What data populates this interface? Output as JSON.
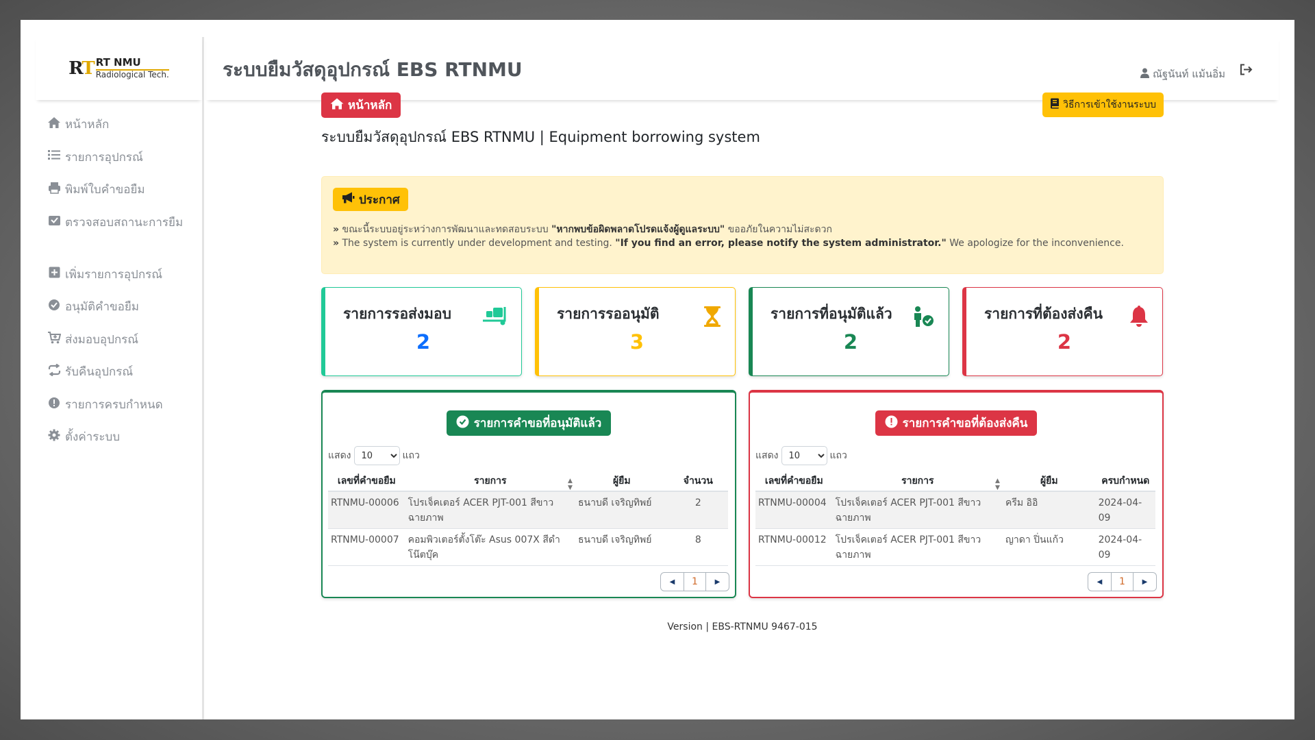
{
  "brand": {
    "mark": "RT",
    "line1": "RT NMU",
    "line2": "Radiological Tech."
  },
  "app_title": "ระบบยืมวัสดุอุปกรณ์ EBS RTNMU",
  "user": {
    "name": "ณัฐนันท์ แม้นอิ่ม"
  },
  "sidebar": {
    "items": [
      {
        "label": "หน้าหลัก",
        "icon": "home-icon"
      },
      {
        "label": "รายการอุปกรณ์",
        "icon": "list-icon"
      },
      {
        "label": "พิมพ์ใบคำขอยืม",
        "icon": "printer-icon"
      },
      {
        "label": "ตรวจสอบสถานะการยืม",
        "icon": "check-inbox-icon"
      },
      {
        "label": "เพิ่มรายการอุปกรณ์",
        "icon": "plus-square-icon"
      },
      {
        "label": "อนุมัติคำขอยืม",
        "icon": "check-circle-icon"
      },
      {
        "label": "ส่งมอบอุปกรณ์",
        "icon": "cart-plus-icon"
      },
      {
        "label": "รับคืนอุปกรณ์",
        "icon": "repeat-icon"
      },
      {
        "label": "รายการครบกำหนด",
        "icon": "exclamation-circle-icon"
      },
      {
        "label": "ตั้งค่าระบบ",
        "icon": "gear-icon"
      }
    ]
  },
  "main": {
    "home_button": "หน้าหลัก",
    "manual_button": "วิธีการเข้าใช้งานระบบ",
    "subtitle": "ระบบยืมวัสดุอุปกรณ์ EBS RTNMU | Equipment borrowing system"
  },
  "announcement": {
    "badge": "ประกาศ",
    "line1_pre": "ขณะนี้ระบบอยู่ระหว่างการพัฒนาและทดสอบระบบ ",
    "line1_bold": "\"หากพบข้อผิดพลาดโปรดแจ้งผู้ดูแลระบบ\"",
    "line1_post": " ขออภัยในความไม่สะดวก",
    "line2_pre": "The system is currently under development and testing. ",
    "line2_bold": "\"If you find an error, please notify the system administrator.\"",
    "line2_post": " We apologize for the inconvenience."
  },
  "stats": [
    {
      "title": "รายการรอส่งมอบ",
      "value": "2",
      "color": "#20c997",
      "value_color": "#0d6efd",
      "icon": "dolly-icon"
    },
    {
      "title": "รายการรออนุมัติ",
      "value": "3",
      "color": "#ffc107",
      "value_color": "#ffc107",
      "icon": "hourglass-icon"
    },
    {
      "title": "รายการที่อนุมัติแล้ว",
      "value": "2",
      "color": "#198754",
      "value_color": "#198754",
      "icon": "person-check-icon"
    },
    {
      "title": "รายการที่ต้องส่งคืน",
      "value": "2",
      "color": "#dc3545",
      "value_color": "#dc3545",
      "icon": "bell-icon"
    }
  ],
  "approved_panel": {
    "title": "รายการคำขอที่อนุมัติแล้ว",
    "color": "#198754",
    "length_prefix": "แสดง",
    "length_value": "10",
    "length_suffix": "แถว",
    "columns": [
      "เลขที่คำขอยืม",
      "รายการ",
      "ผู้ยืม",
      "จำนวน"
    ],
    "rows": [
      [
        "RTNMU-00006",
        "โปรเจ็คเตอร์ ACER PJT-001 สีขาว ฉายภาพ",
        "ธนาบดี เจริญทิพย์",
        "2"
      ],
      [
        "RTNMU-00007",
        "คอมพิวเตอร์ตั้งโต๊ะ Asus 007X สีดำ โน๊ตบุ๊ค",
        "ธนาบดี เจริญทิพย์",
        "8"
      ]
    ],
    "page": "1"
  },
  "return_panel": {
    "title": "รายการคำขอที่ต้องส่งคืน",
    "color": "#dc3545",
    "length_prefix": "แสดง",
    "length_value": "10",
    "length_suffix": "แถว",
    "columns": [
      "เลขที่คำขอยืม",
      "รายการ",
      "ผู้ยืม",
      "ครบกำหนด"
    ],
    "rows": [
      [
        "RTNMU-00004",
        "โปรเจ็คเตอร์ ACER PJT-001 สีขาว ฉายภาพ",
        "ครีม อิอิ",
        "2024-04-09"
      ],
      [
        "RTNMU-00012",
        "โปรเจ็คเตอร์ ACER PJT-001 สีขาว ฉายภาพ",
        "ญาดา ปิ่นแก้ว",
        "2024-04-09"
      ]
    ],
    "page": "1"
  },
  "footer": "Version | EBS-RTNMU 9467-015"
}
